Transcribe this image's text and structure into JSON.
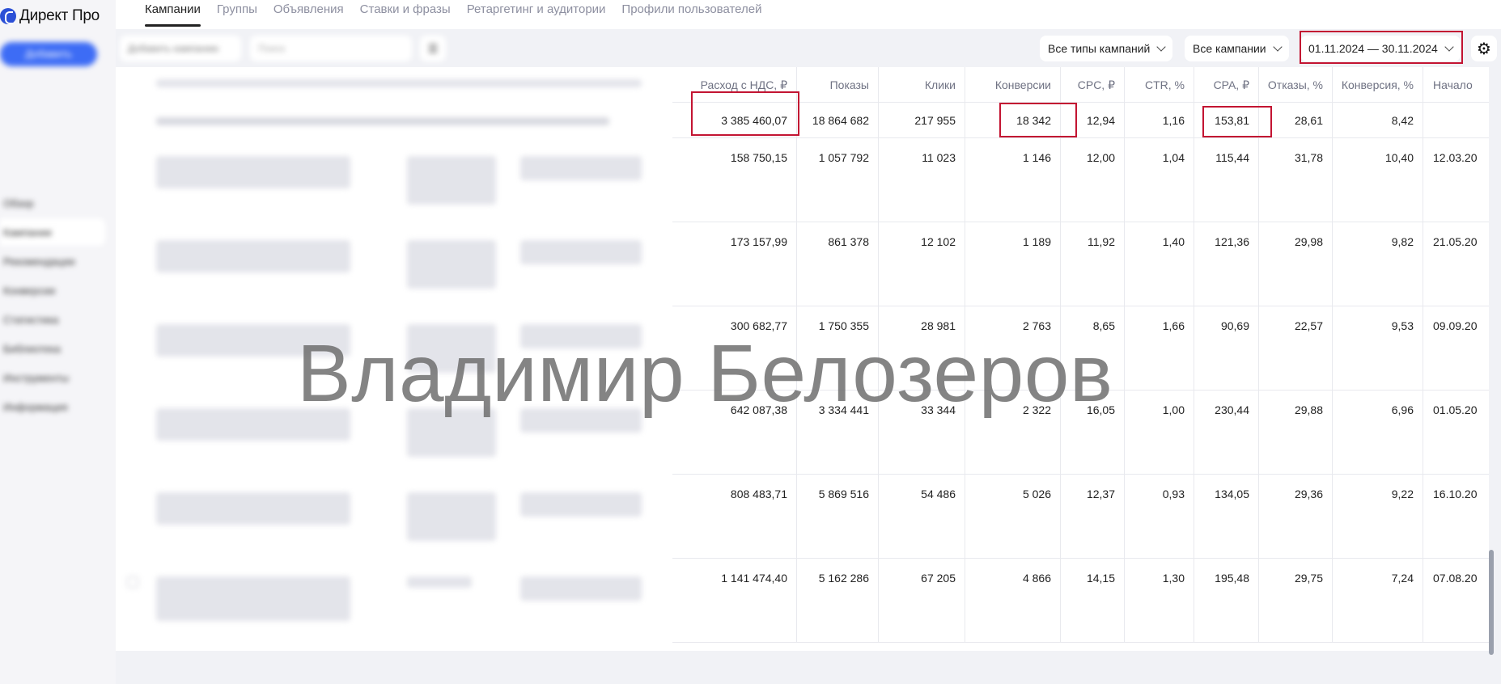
{
  "app": {
    "logo_text": "Директ Про"
  },
  "sidebar": {
    "add_label": "Добавить",
    "items": [
      "Обзор",
      "Кампании",
      "Рекомендации",
      "Конверсии",
      "Статистика",
      "Библиотека",
      "Инструменты",
      "Информация"
    ]
  },
  "tabs": [
    "Кампании",
    "Группы",
    "Объявления",
    "Ставки и фразы",
    "Ретаргетинг и аудитории",
    "Профили пользователей"
  ],
  "toolbar": {
    "add_campaign_label": "Добавить кампанию",
    "search_placeholder": "Поиск",
    "filter_type": "Все типы кампаний",
    "filter_campaigns": "Все кампании",
    "date_range": "01.11.2024 — 30.11.2024"
  },
  "table": {
    "columns": [
      "Расход с НДС, ₽",
      "Показы",
      "Клики",
      "Конверсии",
      "CPC, ₽",
      "CTR, %",
      "CPA, ₽",
      "Отказы, %",
      "Конверсия, %",
      "Начало"
    ],
    "totals": [
      "3 385 460,07",
      "18 864 682",
      "217 955",
      "18 342",
      "12,94",
      "1,16",
      "153,81",
      "28,61",
      "8,42",
      ""
    ],
    "rows": [
      [
        "158 750,15",
        "1 057 792",
        "11 023",
        "1 146",
        "12,00",
        "1,04",
        "115,44",
        "31,78",
        "10,40",
        "12.03.20"
      ],
      [
        "173 157,99",
        "861 378",
        "12 102",
        "1 189",
        "11,92",
        "1,40",
        "121,36",
        "29,98",
        "9,82",
        "21.05.20"
      ],
      [
        "300 682,77",
        "1 750 355",
        "28 981",
        "2 763",
        "8,65",
        "1,66",
        "90,69",
        "22,57",
        "9,53",
        "09.09.20"
      ],
      [
        "642 087,38",
        "3 334 441",
        "33 344",
        "2 322",
        "16,05",
        "1,00",
        "230,44",
        "29,88",
        "6,96",
        "01.05.20"
      ],
      [
        "808 483,71",
        "5 869 516",
        "54 486",
        "5 026",
        "12,37",
        "0,93",
        "134,05",
        "29,36",
        "9,22",
        "16.10.20"
      ],
      [
        "1 141 474,40",
        "5 162 286",
        "67 205",
        "4 866",
        "14,15",
        "1,30",
        "195,48",
        "29,75",
        "7,24",
        "07.08.20"
      ]
    ]
  },
  "watermark": "Владимир Белозеров"
}
